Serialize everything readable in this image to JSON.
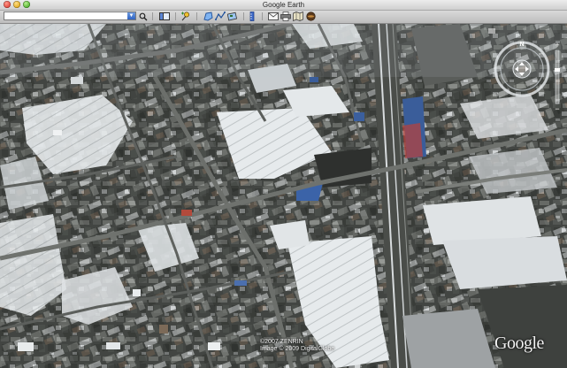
{
  "window": {
    "title": "Google Earth"
  },
  "toolbar": {
    "search": {
      "value": "",
      "placeholder": ""
    },
    "buttons": [
      {
        "name": "search-button",
        "icon": "magnifier-icon"
      },
      {
        "name": "sidebar-toggle-button",
        "icon": "sidebar-icon"
      },
      {
        "name": "placemark-button",
        "icon": "pushpin-icon"
      },
      {
        "name": "polygon-button",
        "icon": "polygon-icon"
      },
      {
        "name": "path-button",
        "icon": "path-icon"
      },
      {
        "name": "overlay-button",
        "icon": "image-overlay-icon"
      },
      {
        "name": "ruler-button",
        "icon": "ruler-icon"
      },
      {
        "name": "email-button",
        "icon": "envelope-icon"
      },
      {
        "name": "print-button",
        "icon": "printer-icon"
      },
      {
        "name": "view-in-maps-button",
        "icon": "map-icon"
      },
      {
        "name": "sky-button",
        "icon": "planet-icon"
      }
    ]
  },
  "map": {
    "copyright_line1": "©2007 ZENRIN",
    "copyright_line2": "Image © 2009 DigitalGlobe",
    "logo": "Google",
    "compass_north": "N",
    "zoom_in": "+",
    "zoom_out": "−"
  },
  "colors": {
    "snow_field": "#e8ecee",
    "road": "#5c5f5c",
    "rooftop_blue": "#3a5d9a",
    "building_dark": "#3b3e3c"
  }
}
